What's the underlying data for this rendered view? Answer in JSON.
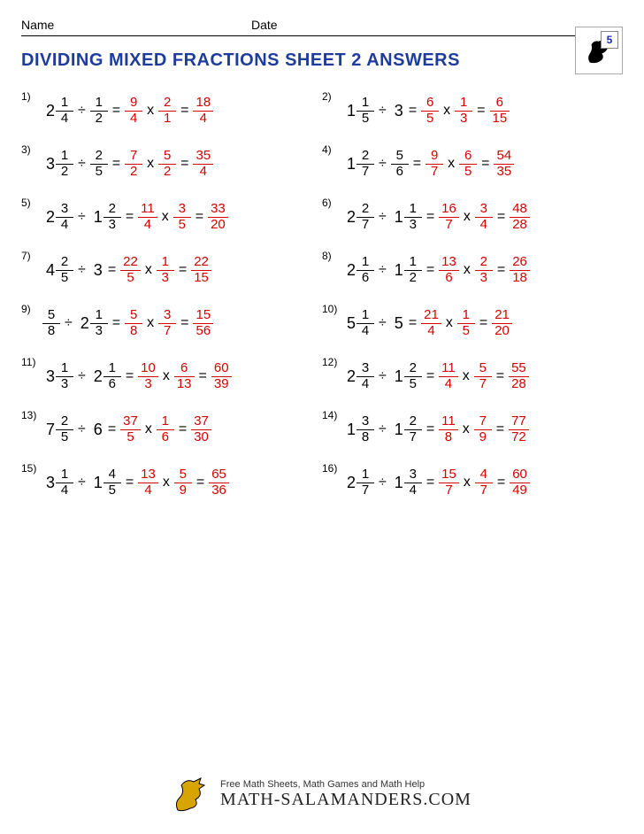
{
  "header": {
    "name_label": "Name",
    "date_label": "Date",
    "grade": "5"
  },
  "title": "DIVIDING MIXED FRACTIONS SHEET 2 ANSWERS",
  "ops": {
    "div": "÷",
    "mul": "x",
    "eq": "="
  },
  "footer": {
    "line": "Free Math Sheets, Math Games and Math Help",
    "url": "MATH-SALAMANDERS.COM"
  },
  "problems": [
    {
      "n": "1)",
      "a": {
        "w": "2",
        "n": "1",
        "d": "4"
      },
      "b": {
        "n": "1",
        "d": "2"
      },
      "c": {
        "n": "9",
        "d": "4"
      },
      "e": {
        "n": "2",
        "d": "1"
      },
      "r": {
        "n": "18",
        "d": "4"
      }
    },
    {
      "n": "2)",
      "a": {
        "w": "1",
        "n": "1",
        "d": "5"
      },
      "b": {
        "w": "3"
      },
      "c": {
        "n": "6",
        "d": "5"
      },
      "e": {
        "n": "1",
        "d": "3"
      },
      "r": {
        "n": "6",
        "d": "15"
      }
    },
    {
      "n": "3)",
      "a": {
        "w": "3",
        "n": "1",
        "d": "2"
      },
      "b": {
        "n": "2",
        "d": "5"
      },
      "c": {
        "n": "7",
        "d": "2"
      },
      "e": {
        "n": "5",
        "d": "2"
      },
      "r": {
        "n": "35",
        "d": "4"
      }
    },
    {
      "n": "4)",
      "a": {
        "w": "1",
        "n": "2",
        "d": "7"
      },
      "b": {
        "n": "5",
        "d": "6"
      },
      "c": {
        "n": "9",
        "d": "7"
      },
      "e": {
        "n": "6",
        "d": "5"
      },
      "r": {
        "n": "54",
        "d": "35"
      }
    },
    {
      "n": "5)",
      "a": {
        "w": "2",
        "n": "3",
        "d": "4"
      },
      "b": {
        "w": "1",
        "n": "2",
        "d": "3"
      },
      "c": {
        "n": "11",
        "d": "4"
      },
      "e": {
        "n": "3",
        "d": "5"
      },
      "r": {
        "n": "33",
        "d": "20"
      }
    },
    {
      "n": "6)",
      "a": {
        "w": "2",
        "n": "2",
        "d": "7"
      },
      "b": {
        "w": "1",
        "n": "1",
        "d": "3"
      },
      "c": {
        "n": "16",
        "d": "7"
      },
      "e": {
        "n": "3",
        "d": "4"
      },
      "r": {
        "n": "48",
        "d": "28"
      }
    },
    {
      "n": "7)",
      "a": {
        "w": "4",
        "n": "2",
        "d": "5"
      },
      "b": {
        "w": "3"
      },
      "c": {
        "n": "22",
        "d": "5"
      },
      "e": {
        "n": "1",
        "d": "3"
      },
      "r": {
        "n": "22",
        "d": "15"
      }
    },
    {
      "n": "8)",
      "a": {
        "w": "2",
        "n": "1",
        "d": "6"
      },
      "b": {
        "w": "1",
        "n": "1",
        "d": "2"
      },
      "c": {
        "n": "13",
        "d": "6"
      },
      "e": {
        "n": "2",
        "d": "3"
      },
      "r": {
        "n": "26",
        "d": "18"
      }
    },
    {
      "n": "9)",
      "a": {
        "n": "5",
        "d": "8"
      },
      "b": {
        "w": "2",
        "n": "1",
        "d": "3"
      },
      "c": {
        "n": "5",
        "d": "8"
      },
      "e": {
        "n": "3",
        "d": "7"
      },
      "r": {
        "n": "15",
        "d": "56"
      }
    },
    {
      "n": "10)",
      "a": {
        "w": "5",
        "n": "1",
        "d": "4"
      },
      "b": {
        "w": "5"
      },
      "c": {
        "n": "21",
        "d": "4"
      },
      "e": {
        "n": "1",
        "d": "5"
      },
      "r": {
        "n": "21",
        "d": "20"
      }
    },
    {
      "n": "11)",
      "a": {
        "w": "3",
        "n": "1",
        "d": "3"
      },
      "b": {
        "w": "2",
        "n": "1",
        "d": "6"
      },
      "c": {
        "n": "10",
        "d": "3"
      },
      "e": {
        "n": "6",
        "d": "13"
      },
      "r": {
        "n": "60",
        "d": "39"
      }
    },
    {
      "n": "12)",
      "a": {
        "w": "2",
        "n": "3",
        "d": "4"
      },
      "b": {
        "w": "1",
        "n": "2",
        "d": "5"
      },
      "c": {
        "n": "11",
        "d": "4"
      },
      "e": {
        "n": "5",
        "d": "7"
      },
      "r": {
        "n": "55",
        "d": "28"
      }
    },
    {
      "n": "13)",
      "a": {
        "w": "7",
        "n": "2",
        "d": "5"
      },
      "b": {
        "w": "6"
      },
      "c": {
        "n": "37",
        "d": "5"
      },
      "e": {
        "n": "1",
        "d": "6"
      },
      "r": {
        "n": "37",
        "d": "30"
      }
    },
    {
      "n": "14)",
      "a": {
        "w": "1",
        "n": "3",
        "d": "8"
      },
      "b": {
        "w": "1",
        "n": "2",
        "d": "7"
      },
      "c": {
        "n": "11",
        "d": "8"
      },
      "e": {
        "n": "7",
        "d": "9"
      },
      "r": {
        "n": "77",
        "d": "72"
      }
    },
    {
      "n": "15)",
      "a": {
        "w": "3",
        "n": "1",
        "d": "4"
      },
      "b": {
        "w": "1",
        "n": "4",
        "d": "5"
      },
      "c": {
        "n": "13",
        "d": "4"
      },
      "e": {
        "n": "5",
        "d": "9"
      },
      "r": {
        "n": "65",
        "d": "36"
      }
    },
    {
      "n": "16)",
      "a": {
        "w": "2",
        "n": "1",
        "d": "7"
      },
      "b": {
        "w": "1",
        "n": "3",
        "d": "4"
      },
      "c": {
        "n": "15",
        "d": "7"
      },
      "e": {
        "n": "4",
        "d": "7"
      },
      "r": {
        "n": "60",
        "d": "49"
      }
    }
  ]
}
